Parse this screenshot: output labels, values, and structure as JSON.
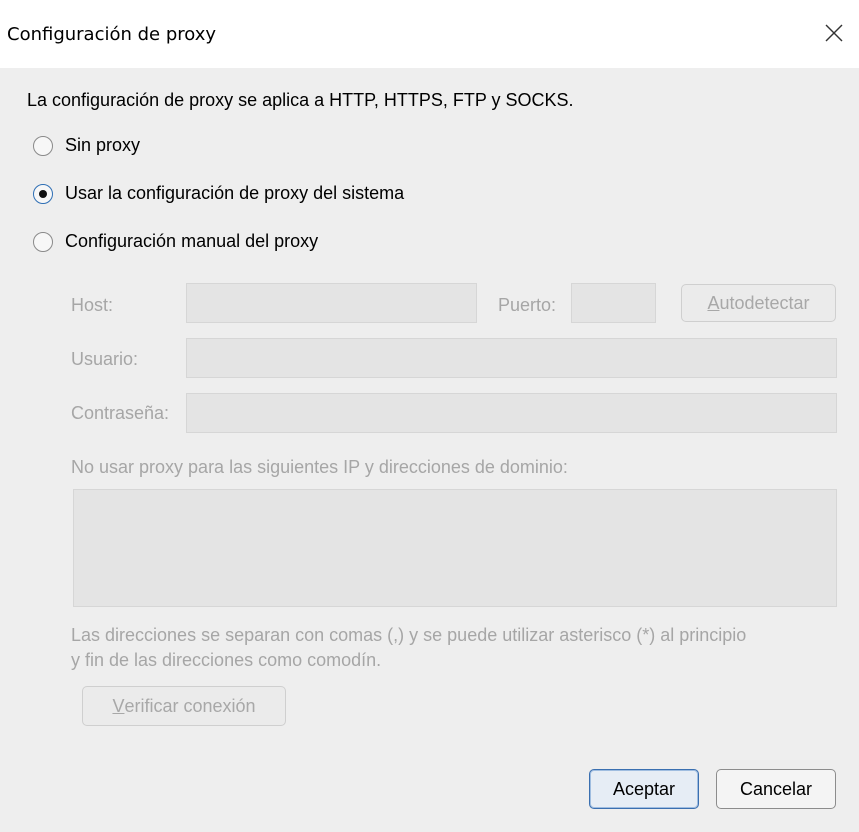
{
  "window": {
    "title": "Configuración de proxy",
    "close_icon": "close-icon"
  },
  "info_text": "La configuración de proxy se aplica a HTTP, HTTPS, FTP y SOCKS.",
  "proxy_options": [
    {
      "label": "Sin proxy",
      "selected": false
    },
    {
      "label": "Usar la configuración de proxy del sistema",
      "selected": true
    },
    {
      "label": "Configuración manual del proxy",
      "selected": false
    }
  ],
  "manual": {
    "host_label": "Host:",
    "host_value": "",
    "port_label": "Puerto:",
    "port_value": "",
    "autodetect_mnemonic": "A",
    "autodetect_rest": "utodetectar",
    "user_label": "Usuario:",
    "user_value": "",
    "password_label": "Contraseña:",
    "password_value": "",
    "bypass_label": "No usar proxy para las siguientes IP y direcciones de dominio:",
    "bypass_value": "",
    "note_line1": "Las direcciones se separan con comas (,) y se puede utilizar asterisco (*) al principio",
    "note_line2": "y fin de las direcciones como comodín.",
    "verify_mnemonic": "V",
    "verify_rest": "erificar conexión"
  },
  "footer": {
    "accept_label": "Aceptar",
    "cancel_label": "Cancelar"
  },
  "colors": {
    "background": "#eeeeee",
    "titlebar": "#ffffff",
    "disabled_text": "#a6a6a6",
    "accent": "#3a6fb0"
  }
}
